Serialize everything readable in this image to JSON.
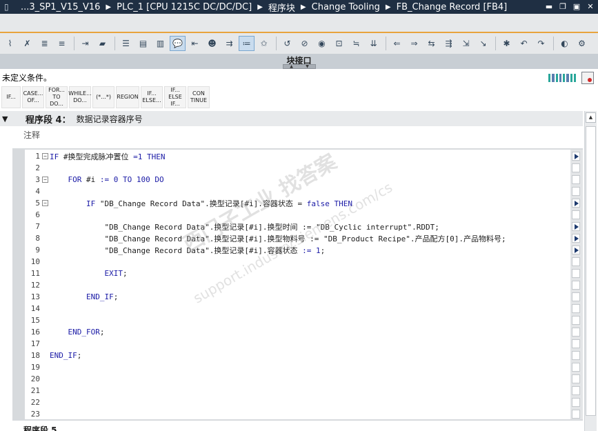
{
  "breadcrumb": {
    "items": [
      "...3_SP1_V15_V16",
      "PLC_1 [CPU 1215C DC/DC/DC]",
      "程序块",
      "Change Tooling",
      "FB_Change Record [FB4]"
    ]
  },
  "window_controls": [
    "minimize",
    "restore",
    "maximize",
    "close"
  ],
  "block_interface": {
    "label": "块接口"
  },
  "condition_text": "未定义条件。",
  "palette": [
    "IF...",
    "CASE...\nOF...",
    "FOR...\nTO DO...",
    "WHILE...\nDO...",
    "(*...*)",
    "REGION",
    "IF...\nELSE...",
    "IF...\nELSE\nIF...",
    "CON\nTINUE"
  ],
  "network": {
    "title": "程序段 4：",
    "name": "数据记录容器序号",
    "comment_placeholder": "注释"
  },
  "next_network_title": "程序段 5",
  "code_lines": [
    {
      "n": "1",
      "text": "IF #换型完成脉冲置位 =1 THEN"
    },
    {
      "n": "2",
      "text": ""
    },
    {
      "n": "3",
      "text": "    FOR #i := 0 TO 100 DO"
    },
    {
      "n": "4",
      "text": ""
    },
    {
      "n": "5",
      "text": "        IF \"DB_Change Record Data\".换型记录[#i].容器状态 = false THEN"
    },
    {
      "n": "6",
      "text": ""
    },
    {
      "n": "7",
      "text": "            \"DB_Change Record Data\".换型记录[#i].换型时间 := \"DB_Cyclic interrupt\".RDDT;"
    },
    {
      "n": "8",
      "text": "            \"DB_Change Record Data\".换型记录[#i].换型物料号 := \"DB_Product Recipe\".产品配方[0].产品物料号;"
    },
    {
      "n": "9",
      "text": "            \"DB_Change Record Data\".换型记录[#i].容器状态 := 1;"
    },
    {
      "n": "10",
      "text": ""
    },
    {
      "n": "11",
      "text": "            EXIT;"
    },
    {
      "n": "12",
      "text": ""
    },
    {
      "n": "13",
      "text": "        END_IF;"
    },
    {
      "n": "14",
      "text": ""
    },
    {
      "n": "15",
      "text": ""
    },
    {
      "n": "16",
      "text": "    END_FOR;"
    },
    {
      "n": "17",
      "text": ""
    },
    {
      "n": "18",
      "text": "END_IF;"
    },
    {
      "n": "19",
      "text": ""
    },
    {
      "n": "20",
      "text": ""
    },
    {
      "n": "21",
      "text": ""
    },
    {
      "n": "22",
      "text": ""
    },
    {
      "n": "23",
      "text": ""
    }
  ],
  "fold_lines": [
    "1",
    "3",
    "5"
  ],
  "marker_lines": [
    "1",
    "5",
    "7",
    "8",
    "9"
  ],
  "watermark": {
    "line1": "西门子工业 找答案",
    "line2": "support.industry.siemens.com/cs"
  }
}
